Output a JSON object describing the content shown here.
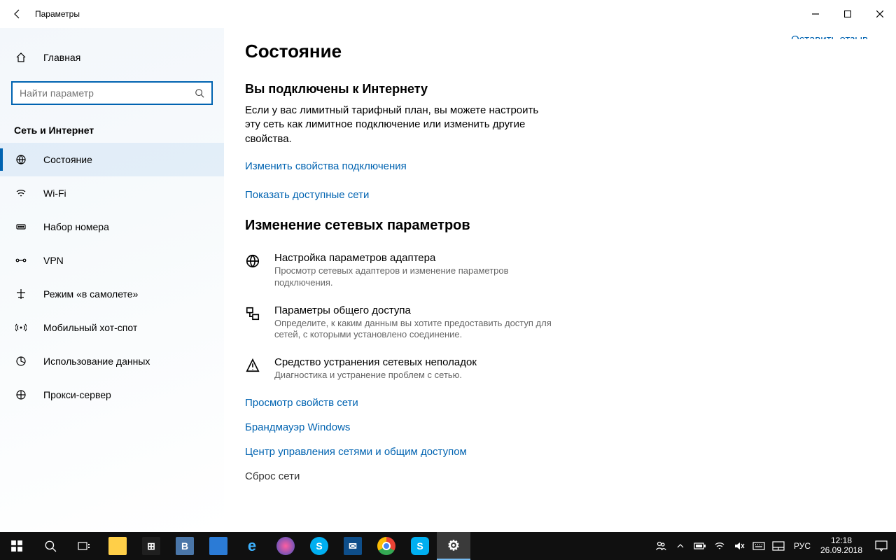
{
  "window": {
    "title": "Параметры",
    "feedback_link": "Оставить отзыв"
  },
  "sidebar": {
    "home": "Главная",
    "search_placeholder": "Найти параметр",
    "category": "Сеть и Интернет",
    "items": [
      {
        "label": "Состояние",
        "active": true
      },
      {
        "label": "Wi-Fi"
      },
      {
        "label": "Набор номера"
      },
      {
        "label": "VPN"
      },
      {
        "label": "Режим «в самолете»"
      },
      {
        "label": "Мобильный хот-спот"
      },
      {
        "label": "Использование данных"
      },
      {
        "label": "Прокси-сервер"
      }
    ]
  },
  "main": {
    "page_title": "Состояние",
    "status_heading": "Вы подключены к Интернету",
    "status_body": "Если у вас лимитный тарифный план, вы можете настроить эту сеть как лимитное подключение или изменить другие свойства.",
    "link_change_props": "Изменить свойства подключения",
    "link_show_nets": "Показать доступные сети",
    "section_heading": "Изменение сетевых параметров",
    "options": [
      {
        "title": "Настройка параметров адаптера",
        "desc": "Просмотр сетевых адаптеров и изменение параметров подключения."
      },
      {
        "title": "Параметры общего доступа",
        "desc": "Определите, к каким данным вы хотите предоставить доступ для сетей, с которыми установлено соединение."
      },
      {
        "title": "Средство устранения сетевых неполадок",
        "desc": "Диагностика и устранение проблем с сетью."
      }
    ],
    "link_view_props": "Просмотр свойств сети",
    "link_firewall": "Брандмауэр Windows",
    "link_sharing_center": "Центр управления сетями и общим доступом",
    "link_reset": "Сброс сети"
  },
  "taskbar": {
    "lang": "РУС",
    "time": "12:18",
    "date": "26.09.2018"
  }
}
